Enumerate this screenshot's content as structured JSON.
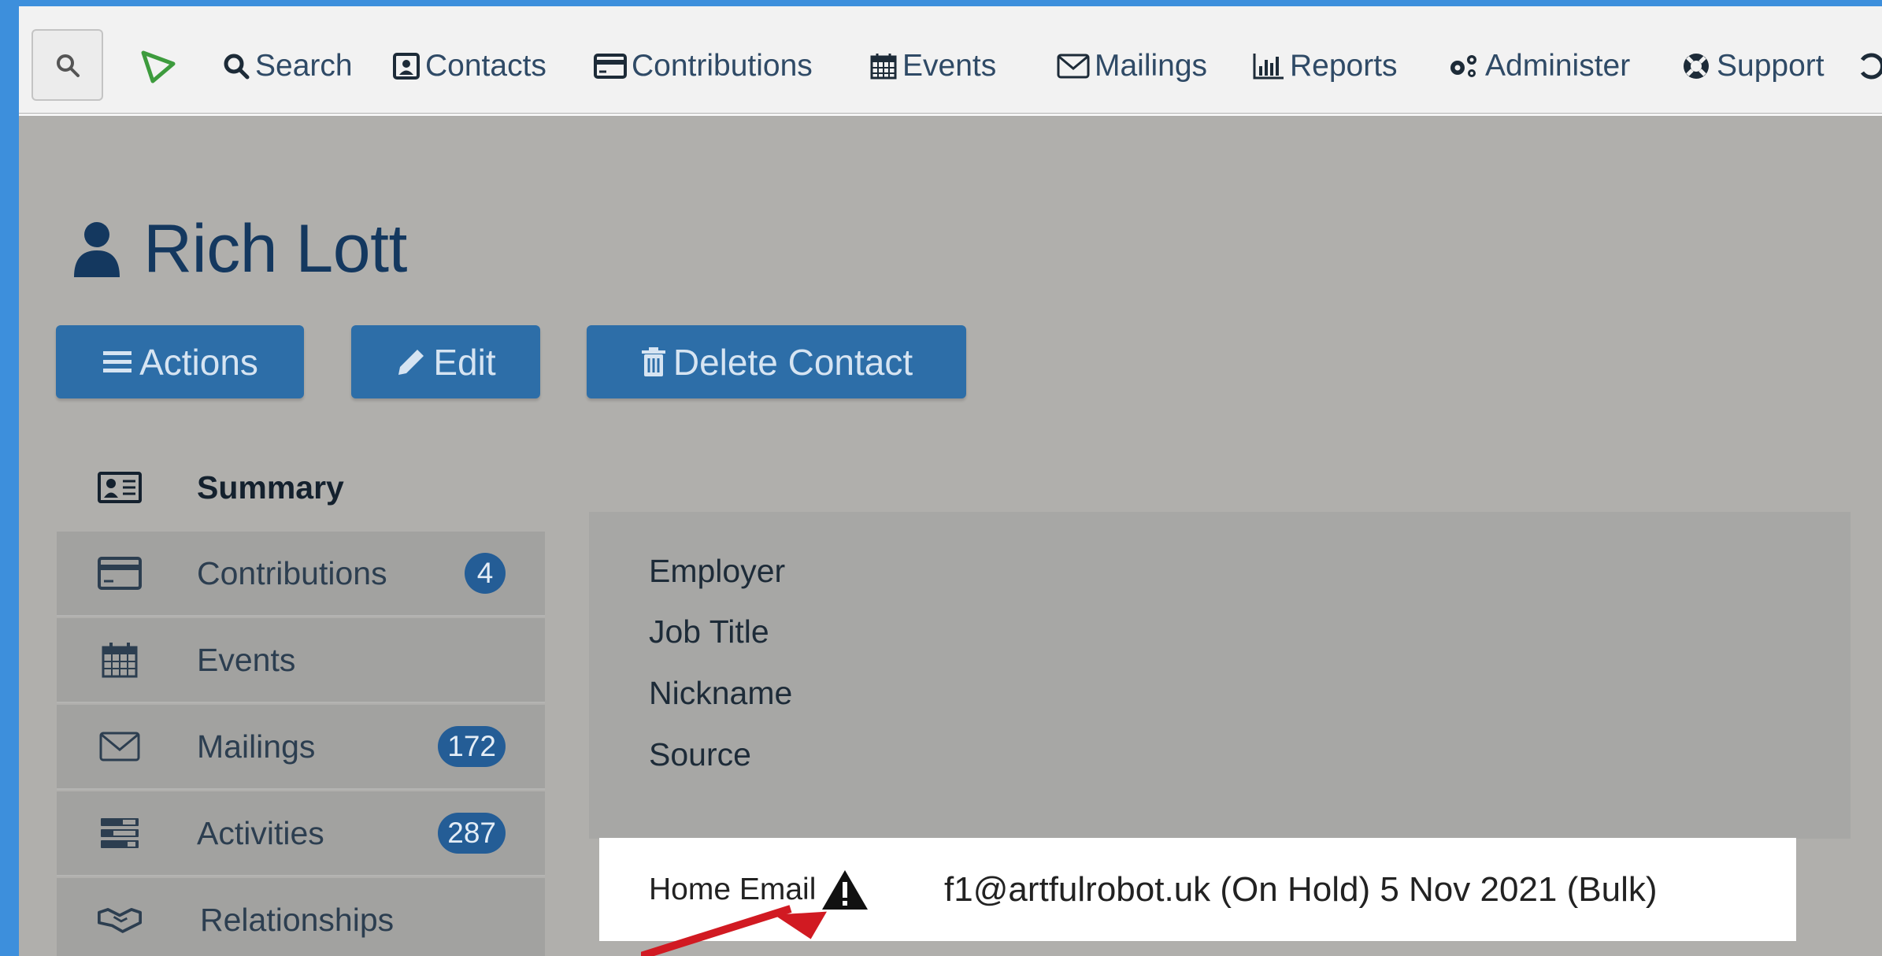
{
  "menubar": {
    "items": [
      {
        "label": "Search",
        "icon": "search-icon"
      },
      {
        "label": "Contacts",
        "icon": "contacts-icon"
      },
      {
        "label": "Contributions",
        "icon": "credit-card-icon"
      },
      {
        "label": "Events",
        "icon": "calendar-icon"
      },
      {
        "label": "Mailings",
        "icon": "envelope-icon"
      },
      {
        "label": "Reports",
        "icon": "bar-chart-icon"
      },
      {
        "label": "Administer",
        "icon": "gears-icon"
      },
      {
        "label": "Support",
        "icon": "life-ring-icon"
      }
    ]
  },
  "contact": {
    "name": "Rich Lott"
  },
  "actions": {
    "actions_label": "Actions",
    "edit_label": "Edit",
    "delete_label": "Delete Contact"
  },
  "tabs": [
    {
      "label": "Summary",
      "icon": "id-card-icon",
      "count": null
    },
    {
      "label": "Contributions",
      "icon": "credit-card-icon",
      "count": "4"
    },
    {
      "label": "Events",
      "icon": "calendar-icon",
      "count": null
    },
    {
      "label": "Mailings",
      "icon": "envelope-icon",
      "count": "172"
    },
    {
      "label": "Activities",
      "icon": "tasks-icon",
      "count": "287"
    },
    {
      "label": "Relationships",
      "icon": "handshake-icon",
      "count": null
    }
  ],
  "fields": {
    "employer": "Employer",
    "job_title": "Job Title",
    "nickname": "Nickname",
    "source": "Source"
  },
  "email": {
    "label": "Home Email",
    "value": "f1@artfulrobot.uk  (On Hold) 5 Nov 2021 (Bulk)"
  },
  "colors": {
    "frame": "#3d8fdc",
    "button": "#2d6ea8",
    "title": "#14385f",
    "badge": "#245d96",
    "arrow": "#d11a22"
  }
}
